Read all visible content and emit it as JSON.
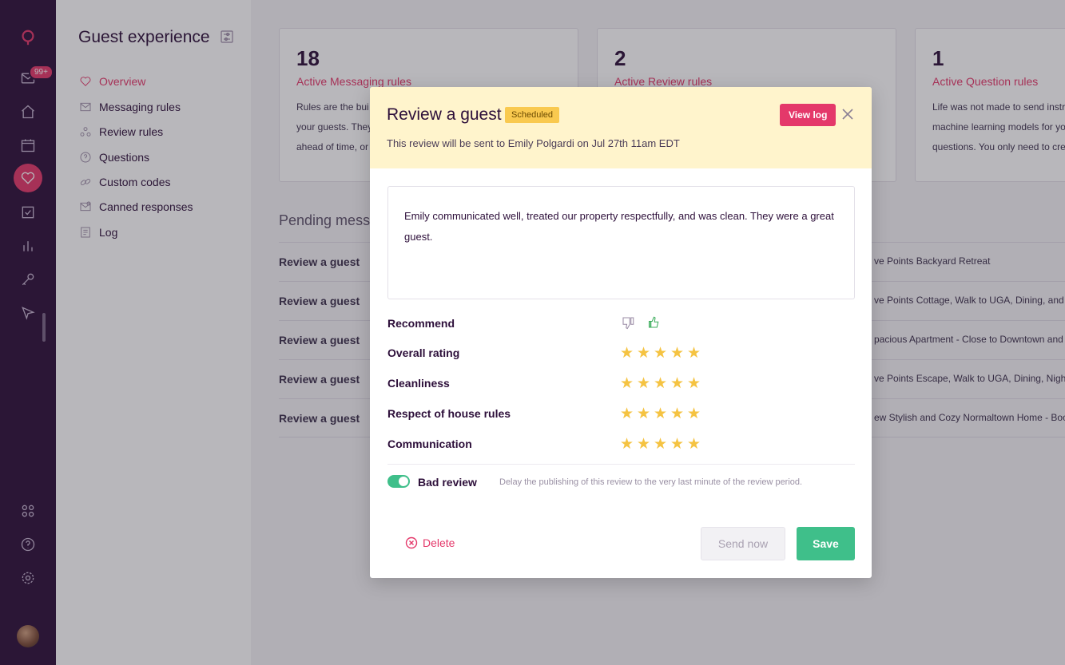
{
  "rail": {
    "badge": "99+",
    "icons": [
      "logo-icon",
      "inbox-icon",
      "home-icon",
      "calendar-icon",
      "heart-icon",
      "checkbox-icon",
      "bar-chart-icon",
      "key-icon",
      "send-icon",
      "apps-icon",
      "help-icon",
      "gear-icon",
      "avatar"
    ]
  },
  "sidebar": {
    "title": "Guest experience",
    "items": [
      {
        "label": "Overview",
        "icon": "heart-icon",
        "active": true
      },
      {
        "label": "Messaging rules",
        "icon": "envelope-icon"
      },
      {
        "label": "Review rules",
        "icon": "review-icon"
      },
      {
        "label": "Questions",
        "icon": "question-icon"
      },
      {
        "label": "Custom codes",
        "icon": "link-icon"
      },
      {
        "label": "Canned responses",
        "icon": "canned-icon"
      },
      {
        "label": "Log",
        "icon": "log-icon"
      }
    ]
  },
  "cards": [
    {
      "num": "18",
      "label": "Active Messaging rules",
      "desc": [
        "Rules are the bui",
        "your guests. They",
        "ahead of time, or"
      ]
    },
    {
      "num": "2",
      "label": "Active Review rules",
      "desc": [
        "",
        "",
        ""
      ]
    },
    {
      "num": "1",
      "label": "Active Question rules",
      "desc": [
        "Life was not made to send instr",
        "machine learning models for yo",
        "questions. You only need to cre"
      ]
    }
  ],
  "pending": {
    "title": "Pending messa",
    "rows": [
      {
        "type": "Review a guest",
        "property": "ve Points Backyard Retreat"
      },
      {
        "type": "Review a guest",
        "property": "ve Points Cottage, Walk to UGA, Dining, and"
      },
      {
        "type": "Review a guest",
        "property": "pacious Apartment - Close to Downtown and"
      },
      {
        "type": "Review a guest",
        "property": "ve Points Escape, Walk to UGA, Dining, Nigh"
      },
      {
        "type": "Review a guest",
        "property": "ew Stylish and Cozy Normaltown Home - Boo"
      }
    ]
  },
  "modal": {
    "title": "Review a guest",
    "status": "Scheduled",
    "view_log": "View log",
    "subtitle": "This review will be sent to Emily Polgardi on Jul 27th 11am EDT",
    "review_text": "Emily communicated well, treated our property respectfully, and was clean. They were a great guest.",
    "recommend_label": "Recommend",
    "recommend_value": "thumbs-up",
    "ratings": [
      {
        "label": "Overall rating",
        "stars": 5
      },
      {
        "label": "Cleanliness",
        "stars": 5
      },
      {
        "label": "Respect of house rules",
        "stars": 5
      },
      {
        "label": "Communication",
        "stars": 5
      }
    ],
    "bad_review_label": "Bad review",
    "bad_review_on": true,
    "bad_review_hint": "Delay the publishing of this review to the very last minute of the review period.",
    "delete_label": "Delete",
    "send_now_label": "Send now",
    "save_label": "Save"
  },
  "colors": {
    "accent": "#e4386a",
    "rail": "#2d0f3a",
    "success": "#3fbf8a",
    "star": "#f5c342",
    "header_bg": "#fff4cc"
  }
}
